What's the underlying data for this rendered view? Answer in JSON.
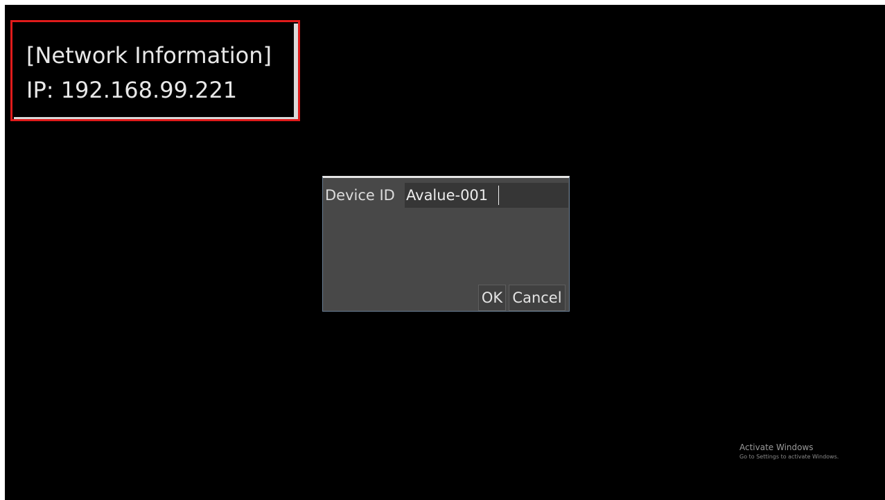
{
  "network_panel": {
    "title": "[Network Information]",
    "ip_line": "IP: 192.168.99.221"
  },
  "dialog": {
    "label": "Device ID",
    "input_value": "Avalue-001",
    "ok_label": "OK",
    "cancel_label": "Cancel"
  },
  "watermark": {
    "title": "Activate Windows",
    "subtitle": "Go to Settings to activate Windows."
  },
  "colors": {
    "background": "#000000",
    "highlight_border": "#e01b1b",
    "dialog_background": "#484848",
    "input_background": "#363636"
  }
}
